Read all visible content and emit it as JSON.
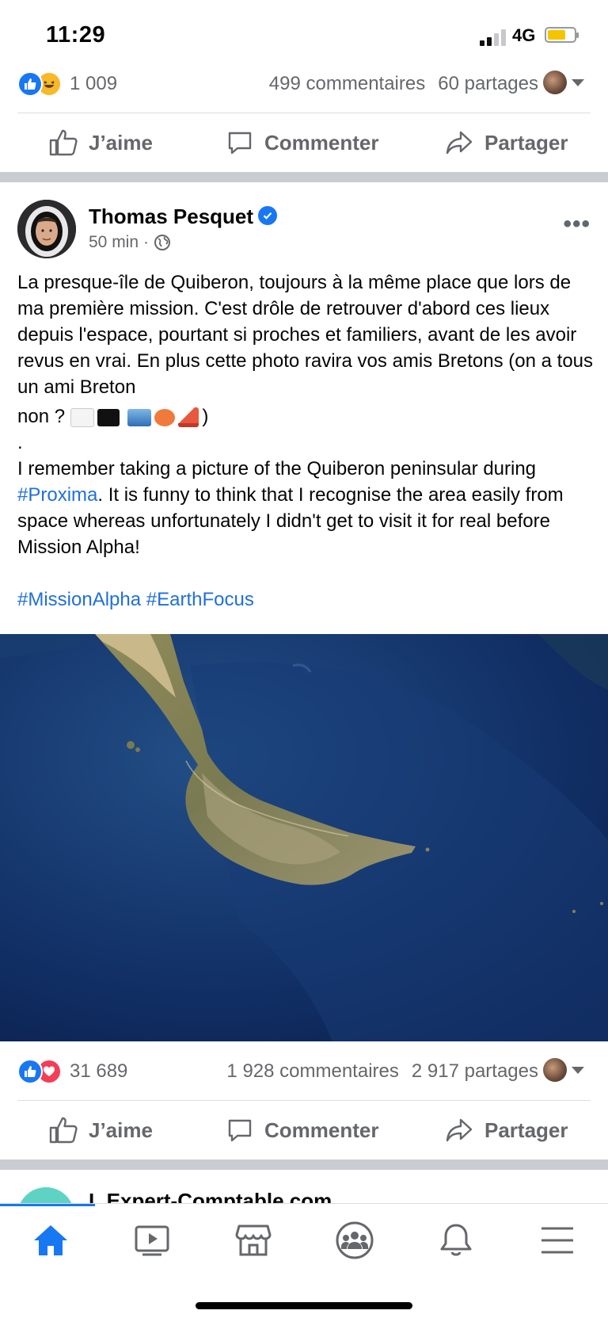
{
  "status_bar": {
    "time": "11:29",
    "network": "4G"
  },
  "prev_post": {
    "reaction_count": "1 009",
    "comments": "499 commentaires",
    "shares": "60 partages"
  },
  "actions": {
    "like": "J’aime",
    "comment": "Commenter",
    "share": "Partager"
  },
  "post": {
    "author": "Thomas Pesquet",
    "time": "50 min",
    "meta_sep": "·",
    "text_fr": "La presque-île de Quiberon, toujours à la même place que lors de ma première mission. C'est drôle de retrouver d'abord ces lieux depuis l'espace, pourtant si proches et familiers, avant de les avoir revus en vrai. En plus cette photo ravira vos amis Bretons (on a tous un ami Breton",
    "text_fr_end_prefix": "non ?",
    "text_fr_end_suffix": ")",
    "dot": ".",
    "text_en_before": "I remember taking a picture of the Quiberon peninsular during ",
    "hashtag_proxima": "#Proxima",
    "text_en_after": ". It is funny to think that I recognise the area easily from space whereas unfortunately I didn't get to visit it for real before Mission Alpha!",
    "hashtags": "#MissionAlpha #EarthFocus",
    "reaction_count": "31 689",
    "comments": "1 928 commentaires",
    "shares": "2 917 partages"
  },
  "next_post": {
    "name": "L Expert-Comptable.com"
  },
  "icons": {
    "like_reaction": "thumbs-up-icon",
    "haha_reaction": "laughing-face-icon",
    "love_reaction": "heart-icon",
    "verified": "verified-badge-icon",
    "globe": "globe-icon",
    "more": "more-icon",
    "nav": [
      "home-icon",
      "video-icon",
      "marketplace-icon",
      "groups-icon",
      "bell-icon",
      "menu-icon"
    ]
  },
  "colors": {
    "accent": "#1877f2",
    "hashtag": "#216fdb",
    "muted": "#65676b",
    "separator": "#c9ccd1"
  }
}
